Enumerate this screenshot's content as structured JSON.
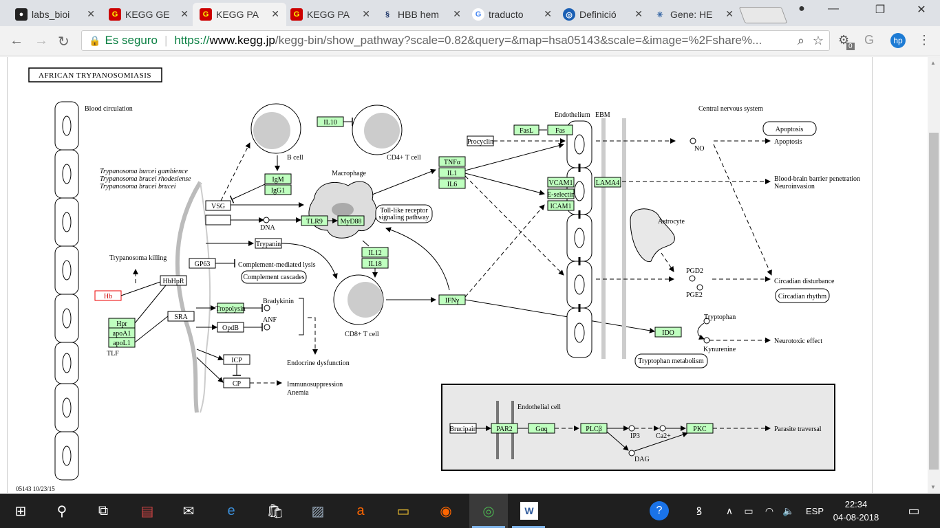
{
  "tabs": [
    {
      "title": "labs_bioi",
      "icon": "github-icon"
    },
    {
      "title": "KEGG GE",
      "icon": "kegg-icon"
    },
    {
      "title": "KEGG PA",
      "icon": "kegg-icon",
      "active": true
    },
    {
      "title": "KEGG PA",
      "icon": "kegg-icon"
    },
    {
      "title": "HBB hem",
      "icon": "dna-icon"
    },
    {
      "title": "traducto",
      "icon": "google-icon"
    },
    {
      "title": "Definició",
      "icon": "dictionary-icon"
    },
    {
      "title": "Gene: HE",
      "icon": "ensembl-icon"
    }
  ],
  "address": {
    "secure_label": "Es seguro",
    "url_prefix": "https://",
    "url_host": "www.kegg.jp",
    "url_rest": "/kegg-bin/show_pathway?scale=0.82&query=&map=hsa05143&scale=&image=%2Fshare%...",
    "ext_badge": "0"
  },
  "pathway": {
    "title": "AFRICAN TRYPANOSOMIASIS",
    "footer": "05143 10/23/15",
    "labels": {
      "blood_circulation": "Blood circulation",
      "tryp1": "Trypanosoma burcei gambience",
      "tryp2": "Trypanosoma brucei rhodesiense",
      "tryp3": "Trypanosoma brucei brucei",
      "b_cell": "B cell",
      "cd4": "CD4+ T cell",
      "macrophage": "Macrophage",
      "dna": "DNA",
      "tlr_path1": "Toll-like receptor",
      "tlr_path2": "signaling pathway",
      "tryp_killing": "Trypanosoma killing",
      "comp_lysis": "Complement-mediated lysis",
      "comp_cascades": "Complement cascades",
      "tlf": "TLF",
      "bradykinin": "Bradykinin",
      "anf": "ANF",
      "endocrine": "Endocrine dysfunction",
      "immuno": "Immunosuppression",
      "anemia": "Anemia",
      "cd8": "CD8+ T cell",
      "endothelium": "Endothelium",
      "ebm": "EBM",
      "cns": "Central nervous system",
      "no": "NO",
      "apoptosis_box": "Apoptosis",
      "apoptosis": "Apoptosis",
      "bbb1": "Blood-brain barrier penetration",
      "bbb2": "Neuroinvasion",
      "astrocyte": "Astrocyte",
      "pgd2": "PGD2",
      "pge2": "PGE2",
      "circ_dist": "Circadian disturbance",
      "circ_rhythm": "Circadian rhythm",
      "tryptophan": "Tryptophan",
      "kynurenine": "Kynurenine",
      "neurotoxic": "Neurotoxic effect",
      "tryp_metab": "Tryptophan metabolism",
      "endothelial_cell": "Endothelial cell",
      "ip3": "IP3",
      "ca2": "Ca2+",
      "dag": "DAG",
      "parasite_traversal": "Parasite traversal"
    },
    "genes": {
      "il10": "IL10",
      "igm": "IgM",
      "igg1": "IgG1",
      "tlr9": "TLR9",
      "myd88": "MyD88",
      "tnfa": "TNFα",
      "il1": "IL1",
      "il6": "IL6",
      "il12": "IL12",
      "il18": "IL18",
      "ifng": "IFNγ",
      "fasl": "FasL",
      "fas": "Fas",
      "vcam1": "VCAM1",
      "eselectin": "E-selectin",
      "icam1": "ICAM1",
      "lama4": "LAMA4",
      "ido": "IDO",
      "hb": "Hb",
      "hpr": "Hpr",
      "apoa1": "apoA1",
      "apol1": "apoL1",
      "par2": "PAR2",
      "gaq": "Gαq",
      "plcb": "PLCβ",
      "pkc": "PKC"
    },
    "compounds": {
      "vsg": "VSG",
      "procyclin": "Procyclin",
      "trypanin": "Trypanin",
      "gp63": "GP63",
      "hbhpr": "HbHpR",
      "sra": "SRA",
      "tropolysin": "Tropolysin",
      "oligopeptidase": "OpdB",
      "icp": "ICP",
      "cp": "CP",
      "brucipain": "Brucipain"
    }
  },
  "taskbar": {
    "time": "22:34",
    "date": "04-08-2018",
    "lang": "ESP"
  }
}
